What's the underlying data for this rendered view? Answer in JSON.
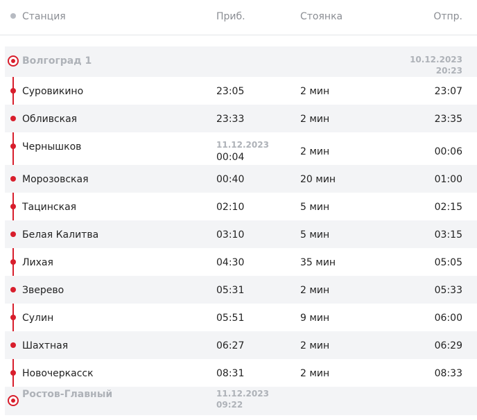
{
  "header": {
    "station": "Станция",
    "arrival": "Приб.",
    "stop": "Стоянка",
    "departure": "Отпр."
  },
  "origin": {
    "name": "Волгоград 1",
    "dep_date": "10.12.2023",
    "dep_time": "20:23"
  },
  "stations": [
    {
      "name": "Суровикино",
      "arr": "23:05",
      "stop": "2 мин",
      "dep": "23:07"
    },
    {
      "name": "Обливская",
      "arr": "23:33",
      "stop": "2 мин",
      "dep": "23:35"
    },
    {
      "name": "Чернышков",
      "arr_date": "11.12.2023",
      "arr": "00:04",
      "stop": "2 мин",
      "dep": "00:06"
    },
    {
      "name": "Морозовская",
      "arr": "00:40",
      "stop": "20 мин",
      "dep": "01:00"
    },
    {
      "name": "Тацинская",
      "arr": "02:10",
      "stop": "5 мин",
      "dep": "02:15"
    },
    {
      "name": "Белая Калитва",
      "arr": "03:10",
      "stop": "5 мин",
      "dep": "03:15"
    },
    {
      "name": "Лихая",
      "arr": "04:30",
      "stop": "35 мин",
      "dep": "05:05"
    },
    {
      "name": "Зверево",
      "arr": "05:31",
      "stop": "2 мин",
      "dep": "05:33"
    },
    {
      "name": "Сулин",
      "arr": "05:51",
      "stop": "9 мин",
      "dep": "06:00"
    },
    {
      "name": "Шахтная",
      "arr": "06:27",
      "stop": "2 мин",
      "dep": "06:29"
    },
    {
      "name": "Новочеркасск",
      "arr": "08:31",
      "stop": "2 мин",
      "dep": "08:33"
    }
  ],
  "destination": {
    "name": "Ростов-Главный",
    "arr_date": "11.12.2023",
    "arr_time": "09:22"
  },
  "colors": {
    "accent": "#d81e2c",
    "row_shade": "#f3f4f6",
    "muted": "#8a8d93"
  }
}
